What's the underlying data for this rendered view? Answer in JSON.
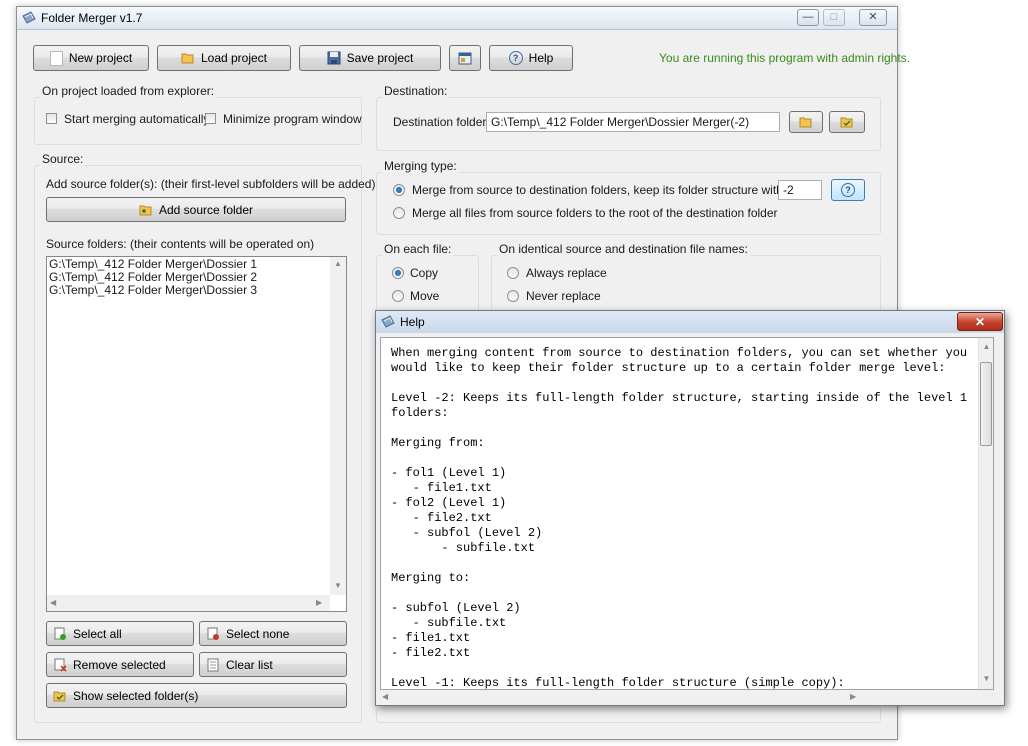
{
  "main_window": {
    "title": "Folder Merger v1.7"
  },
  "toolbar": {
    "new_project": "New project",
    "load_project": "Load project",
    "save_project": "Save project",
    "help": "Help",
    "admin_status": "You are running this program with admin rights."
  },
  "explorer_group": {
    "title": "On project loaded from explorer:",
    "start_merging": "Start merging automatically",
    "minimize_window": "Minimize program window"
  },
  "destination": {
    "title": "Destination:",
    "folder_label": "Destination folder:",
    "folder_value": "G:\\Temp\\_412 Folder Merger\\Dossier Merger(-2)"
  },
  "merging_type": {
    "title": "Merging type:",
    "option_structure": "Merge from source to destination folders, keep its folder structure with level:",
    "level_value": "-2",
    "option_root": "Merge all files from source folders to the root of the destination folder"
  },
  "each_file": {
    "title": "On each file:",
    "copy": "Copy",
    "move": "Move"
  },
  "identical_names": {
    "title": "On identical source and destination file names:",
    "always_replace": "Always replace",
    "never_replace": "Never replace"
  },
  "source": {
    "title": "Source:",
    "add_hint": "Add source folder(s): (their first-level subfolders will be added)",
    "add_button": "Add source folder",
    "list_hint": "Source folders: (their contents will be operated on)",
    "folders": [
      "G:\\Temp\\_412 Folder Merger\\Dossier 1",
      "G:\\Temp\\_412 Folder Merger\\Dossier 2",
      "G:\\Temp\\_412 Folder Merger\\Dossier 3"
    ],
    "select_all": "Select all",
    "select_none": "Select none",
    "remove_selected": "Remove selected",
    "clear_list": "Clear list",
    "show_selected": "Show selected folder(s)"
  },
  "help_window": {
    "title": "Help",
    "text": "When merging content from source to destination folders, you can set whether you\nwould like to keep their folder structure up to a certain folder merge level:\n\nLevel -2: Keeps its full-length folder structure, starting inside of the level 1\nfolders:\n\nMerging from:\n\n- fol1 (Level 1)\n   - file1.txt\n- fol2 (Level 1)\n   - file2.txt\n   - subfol (Level 2)\n       - subfile.txt\n\nMerging to:\n\n- subfol (Level 2)\n   - subfile.txt\n- file1.txt\n- file2.txt\n\nLevel -1: Keeps its full-length folder structure (simple copy):"
  },
  "colors": {
    "admin_text": "#3a8a1e",
    "group_border": "#d5dfe5",
    "window_bg": "#f0f0f0"
  }
}
